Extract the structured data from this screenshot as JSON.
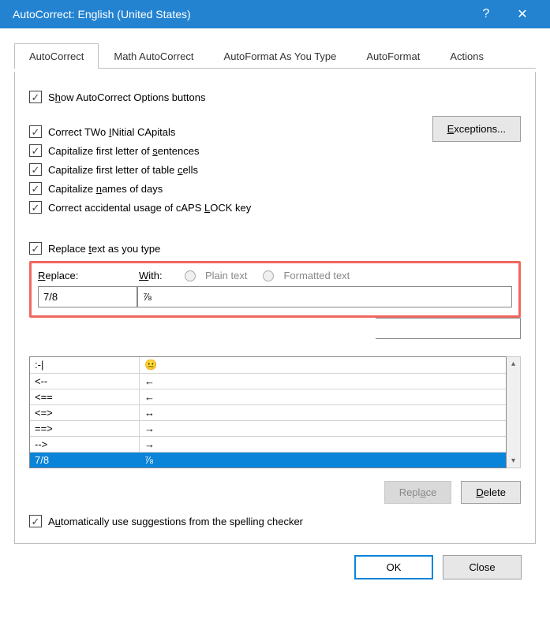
{
  "title": "AutoCorrect: English (United States)",
  "tabs": [
    "AutoCorrect",
    "Math AutoCorrect",
    "AutoFormat As You Type",
    "AutoFormat",
    "Actions"
  ],
  "activeTab": 0,
  "checks": {
    "show": {
      "pre": "S",
      "u": "h",
      "post": "ow AutoCorrect Options buttons"
    },
    "two": {
      "pre": "Correct TWo ",
      "u": "I",
      "post": "Nitial CApitals"
    },
    "sent": {
      "pre": "Capitalize first letter of ",
      "u": "s",
      "post": "entences"
    },
    "cells": {
      "pre": "Capitalize first letter of table ",
      "u": "c",
      "post": "ells"
    },
    "days": {
      "pre": "Capitalize ",
      "u": "n",
      "post": "ames of days"
    },
    "caps": {
      "pre": "Correct accidental usage of cAPS ",
      "u": "L",
      "post": "OCK key"
    },
    "replaceAsType": {
      "pre": "Replace ",
      "u": "t",
      "post": "ext as you type"
    },
    "autoSuggest": {
      "pre": "A",
      "u": "u",
      "post": "tomatically use suggestions from the spelling checker"
    }
  },
  "exceptions": {
    "u": "E",
    "post": "xceptions..."
  },
  "replaceLabel": {
    "u": "R",
    "post": "eplace:"
  },
  "withLabel": {
    "u": "W",
    "post": "ith:"
  },
  "radios": {
    "plain": "Plain text",
    "formatted": "Formatted text"
  },
  "inputs": {
    "replace": "7/8",
    "with": "⅞"
  },
  "list": [
    {
      "a": ":-|",
      "b": "😐"
    },
    {
      "a": "<--",
      "b": "←"
    },
    {
      "a": "<==",
      "b": "←"
    },
    {
      "a": "<=>",
      "b": "↔"
    },
    {
      "a": "==>",
      "b": "→"
    },
    {
      "a": "-->",
      "b": "→"
    },
    {
      "a": "7/8",
      "b": "⅞",
      "selected": true
    }
  ],
  "btns": {
    "replace": {
      "pre": "Repl",
      "u": "a",
      "post": "ce"
    },
    "delete": {
      "u": "D",
      "post": "elete"
    },
    "ok": "OK",
    "close": "Close"
  }
}
